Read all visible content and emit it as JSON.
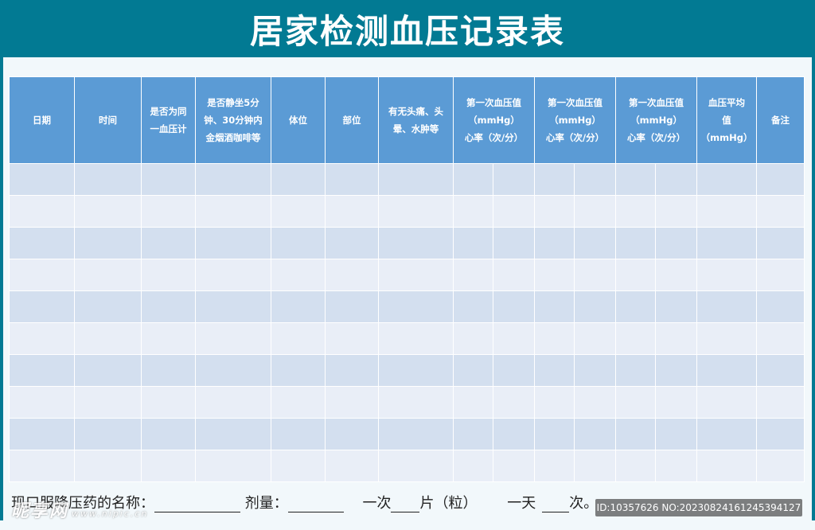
{
  "title": "居家检测血压记录表",
  "table": {
    "headers": [
      [
        "日期"
      ],
      [
        "时间"
      ],
      [
        "是否为同",
        "一血压计"
      ],
      [
        "是否静坐5分",
        "钟、30分钟内",
        "金烟酒咖啡等"
      ],
      [
        "体位"
      ],
      [
        "部位"
      ],
      [
        "有无头痛、头",
        "晕、水肿等"
      ],
      [
        "第一次血压值",
        "（mmHg）",
        "心率（次/分）"
      ],
      [
        "第一次血压值",
        "（mmHg）",
        "心率（次/分）"
      ],
      [
        "第一次血压值",
        "（mmHg）",
        "心率（次/分）"
      ],
      [
        "血压平均",
        "值",
        "（mmHg）"
      ],
      [
        "备注"
      ]
    ],
    "row_count": 10
  },
  "footer": {
    "medicine_label": "现口服降压药的名称：",
    "dose_label": "剂量：",
    "per_time_label": "一次",
    "unit_label": "片（粒）",
    "per_day_label": "一天",
    "times_label": "次。"
  },
  "watermark": {
    "logo": "昵享网",
    "site": "www.nipic.cn",
    "id_text": "ID:10357626 NO:20230824161245394127"
  },
  "colors": {
    "brand_teal": "#027a93",
    "header_blue": "#5b9bd5",
    "row_dark": "#d3dfef",
    "row_light": "#e9eef7"
  }
}
